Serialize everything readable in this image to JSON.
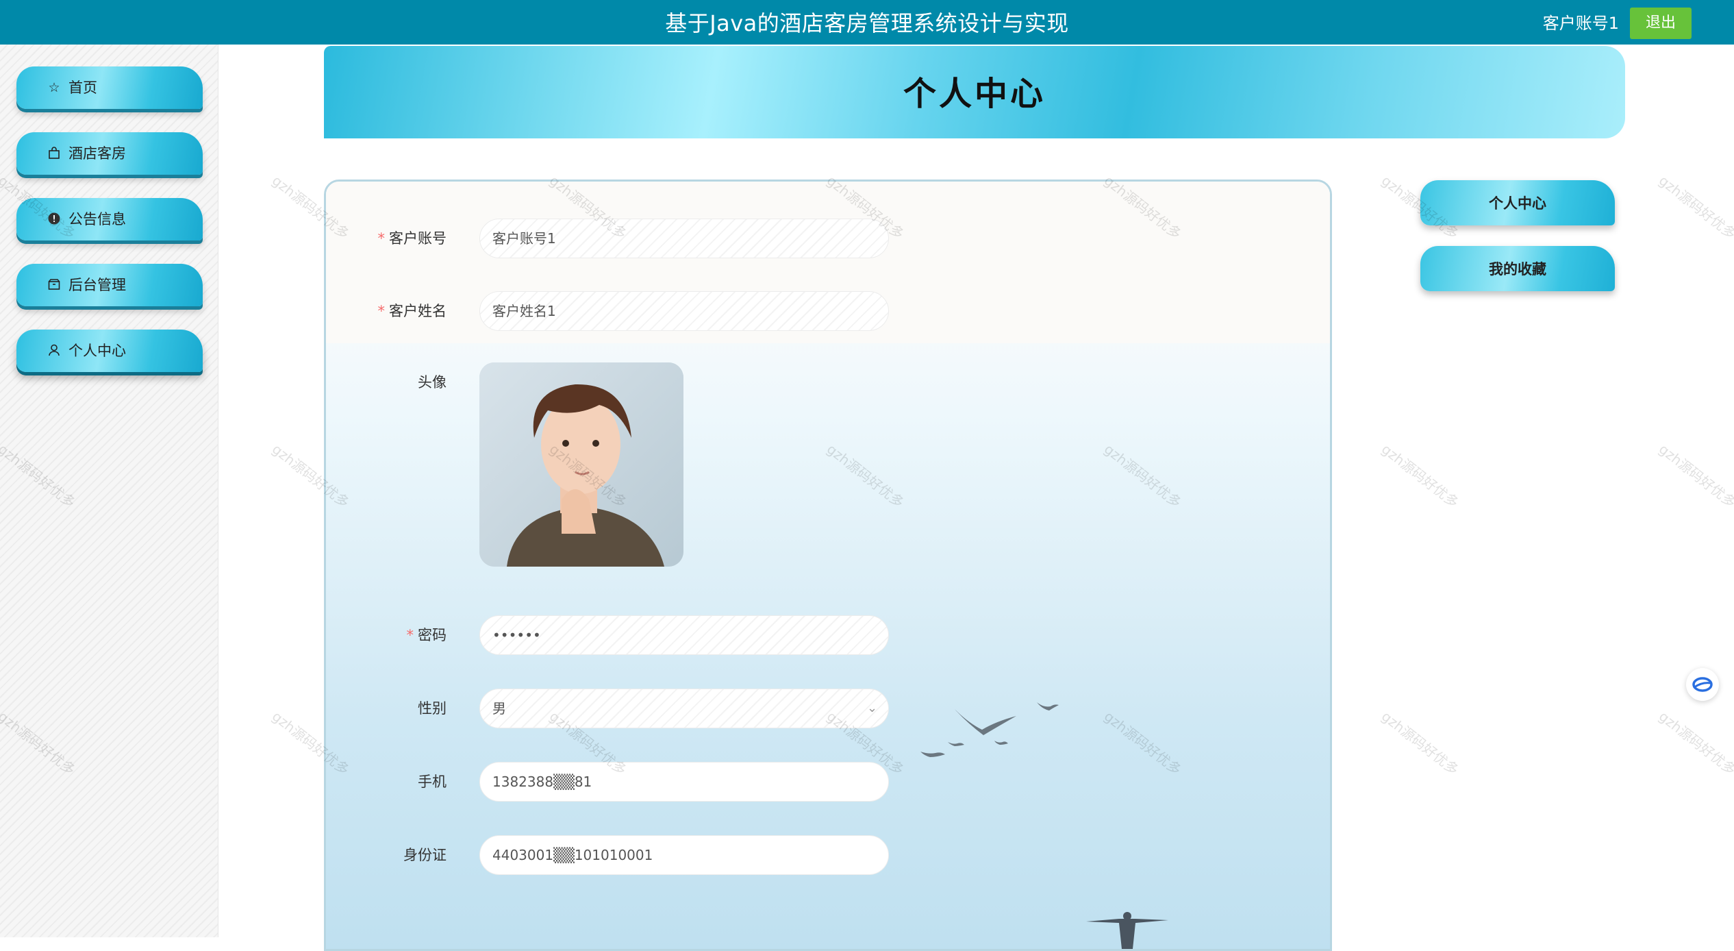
{
  "header": {
    "title": "基于Java的酒店客房管理系统设计与实现",
    "username": "客户账号1",
    "logout_label": "退出",
    "bg_color": "#0089a9",
    "logout_color": "#67c23a"
  },
  "sidebar": {
    "items": [
      {
        "label": "首页",
        "icon": "star-icon"
      },
      {
        "label": "酒店客房",
        "icon": "bag-icon"
      },
      {
        "label": "公告信息",
        "icon": "info-icon"
      },
      {
        "label": "后台管理",
        "icon": "box-icon"
      },
      {
        "label": "个人中心",
        "icon": "user-icon",
        "active": true
      }
    ]
  },
  "page": {
    "title": "个人中心"
  },
  "form": {
    "account": {
      "label": "客户账号",
      "value": "客户账号1",
      "required": true
    },
    "name": {
      "label": "客户姓名",
      "value": "客户姓名1",
      "required": true
    },
    "avatar": {
      "label": "头像"
    },
    "password": {
      "label": "密码",
      "value": "••••••",
      "required": true
    },
    "gender": {
      "label": "性别",
      "value": "男"
    },
    "phone": {
      "label": "手机",
      "value": "1382388▒▒81"
    },
    "idcard": {
      "label": "身份证",
      "value": "4403001▒▒101010001"
    }
  },
  "right_menu": {
    "items": [
      {
        "label": "个人中心"
      },
      {
        "label": "我的收藏"
      }
    ]
  },
  "watermark": "gzh源码好优多"
}
